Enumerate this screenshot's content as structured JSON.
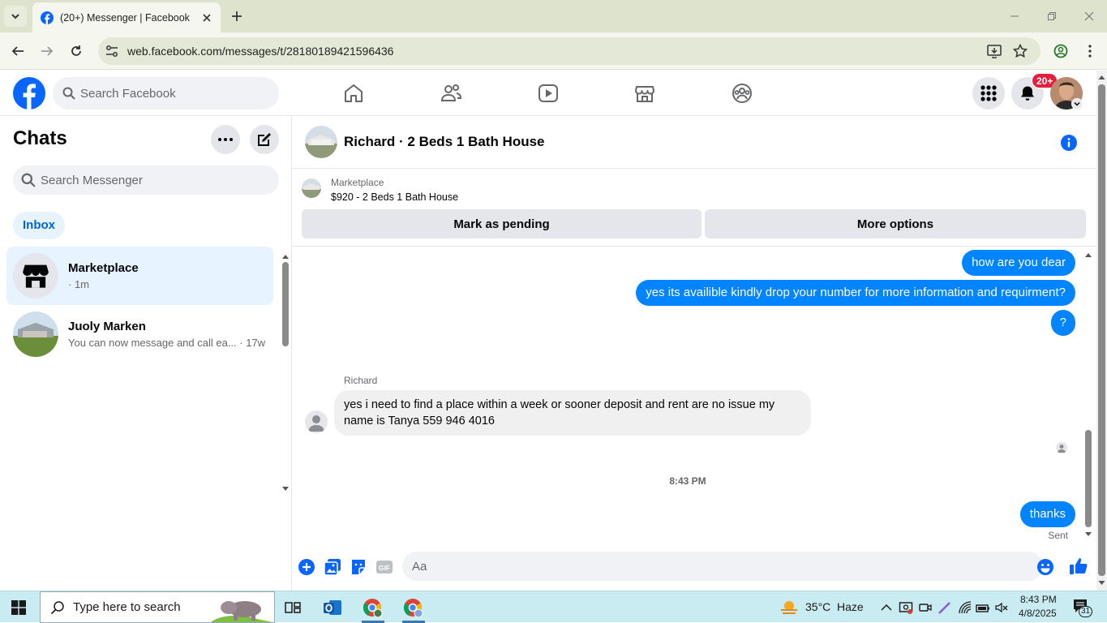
{
  "browser": {
    "tab_title": "(20+) Messenger | Facebook",
    "url": "web.facebook.com/messages/t/28180189421596436"
  },
  "fb_header": {
    "search_placeholder": "Search Facebook",
    "notification_badge": "20+"
  },
  "chats": {
    "title": "Chats",
    "search_placeholder": "Search Messenger",
    "filter_inbox": "Inbox",
    "items": [
      {
        "name": "Marketplace",
        "preview": "· 1m",
        "active": true
      },
      {
        "name": "Juoly Marken",
        "preview": "You can now message and call ea... · 17w",
        "active": false
      }
    ]
  },
  "conversation": {
    "title": "Richard · 2 Beds 1 Bath House",
    "marketplace_label": "Marketplace",
    "listing": "$920 - 2 Beds 1 Bath House",
    "btn_pending": "Mark as pending",
    "btn_more": "More options",
    "messages_out_1": "how are you dear",
    "messages_out_2": "yes its availible kindly drop your number for more information and requirment?",
    "messages_out_3": "?",
    "sender_name": "Richard",
    "message_in": "yes i need to find a place within a week or sooner deposit and rent are no issue my name is Tanya 559 946 4016",
    "timestamp": "8:43 PM",
    "message_out_last": "thanks",
    "status": "Sent",
    "composer_placeholder": "Aa"
  },
  "taskbar": {
    "search_placeholder": "Type here to search",
    "weather_temp": "35°C",
    "weather_desc": "Haze",
    "time": "8:43 PM",
    "date": "4/8/2025",
    "notif_count": "31"
  },
  "colors": {
    "fb_blue": "#0866ff",
    "bubble_blue": "#0084ff",
    "badge_red": "#e41e3f"
  }
}
